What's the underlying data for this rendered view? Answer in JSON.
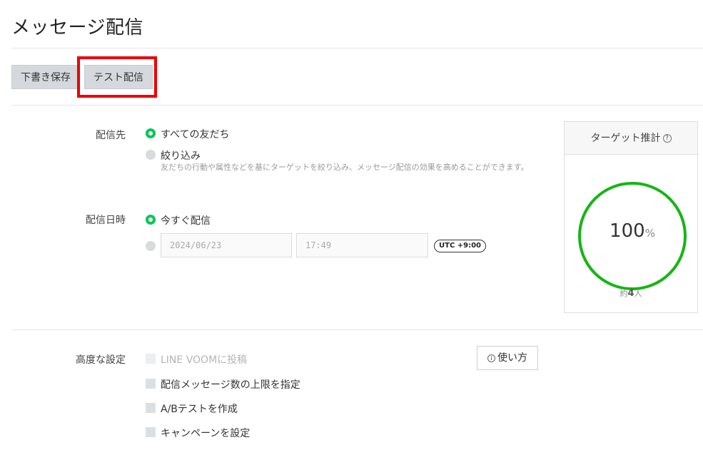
{
  "page": {
    "title": "メッセージ配信"
  },
  "toolbar": {
    "draft_label": "下書き保存",
    "test_label": "テスト配信"
  },
  "delivery_target": {
    "label": "配信先",
    "options": [
      {
        "label": "すべての友だち",
        "selected": true
      },
      {
        "label": "絞り込み",
        "selected": false,
        "help": "友だちの行動や属性などを基にターゲットを絞り込み、メッセージ配信の効果を高めることができます。"
      }
    ]
  },
  "delivery_time": {
    "label": "配信日時",
    "options": [
      {
        "label": "今すぐ配信",
        "selected": true
      },
      {
        "label": "",
        "selected": false
      }
    ],
    "date_value": "2024/06/23",
    "time_value": "17:49",
    "timezone": "UTC +9:00"
  },
  "target_estimate": {
    "title": "ターゲット推計",
    "help_icon": "question-circle-icon",
    "percent": "100",
    "percent_unit": "%",
    "count_prefix": "約",
    "count_value": "4",
    "count_suffix": "人",
    "gauge_color": "#14b614"
  },
  "advanced": {
    "label": "高度な設定",
    "howto_label": "使い方",
    "howto_icon": "info-circle-icon",
    "options": [
      {
        "label": "LINE VOOMに投稿",
        "checked": false,
        "disabled": true
      },
      {
        "label": "配信メッセージ数の上限を指定",
        "checked": false,
        "disabled": false
      },
      {
        "label": "A/Bテストを作成",
        "checked": false,
        "disabled": false
      },
      {
        "label": "キャンペーンを設定",
        "checked": false,
        "disabled": false
      }
    ]
  },
  "colors": {
    "accent_green": "#06c755",
    "highlight_red": "#ef0000"
  }
}
